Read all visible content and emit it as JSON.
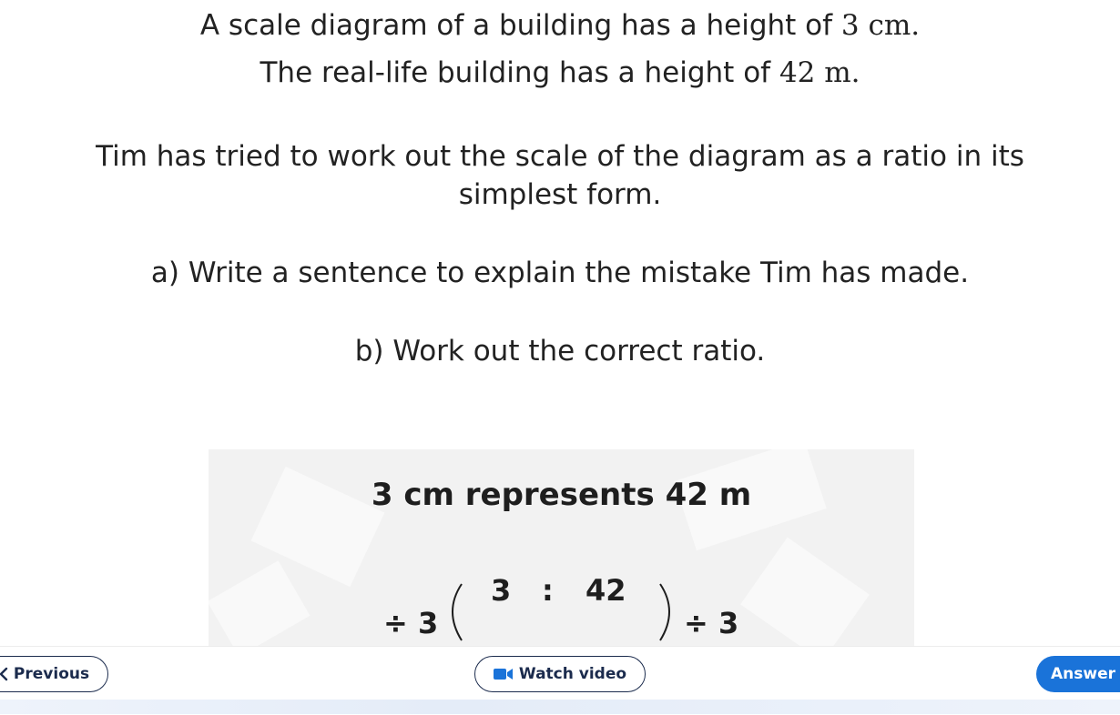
{
  "question": {
    "line1_text": "A scale diagram of a building has a height of ",
    "line1_value": "3 cm.",
    "line2_text": "The real-life building has a height of ",
    "line2_value": "42 m.",
    "line3": "Tim has tried to work out the scale of the diagram as a ratio in its",
    "line4": "simplest form.",
    "part_a": "a) Write a sentence to explain the mistake Tim has made.",
    "part_b": "b) Work out the correct ratio."
  },
  "worked": {
    "heading": "3 cm represents 42 m",
    "left_op": "÷ 3",
    "ratio_left": "3",
    "ratio_colon": ":",
    "ratio_right": "42",
    "right_op": "÷ 3"
  },
  "nav": {
    "previous_label": "Previous",
    "video_label": "Watch video",
    "answer_label": "Answer"
  },
  "icons": {
    "previous": "chevron-left-icon",
    "video": "video-camera-icon"
  },
  "colors": {
    "answer_bg": "#1a73d9",
    "outline": "#1b2b4d",
    "panel_bg": "#f2f2f2"
  }
}
